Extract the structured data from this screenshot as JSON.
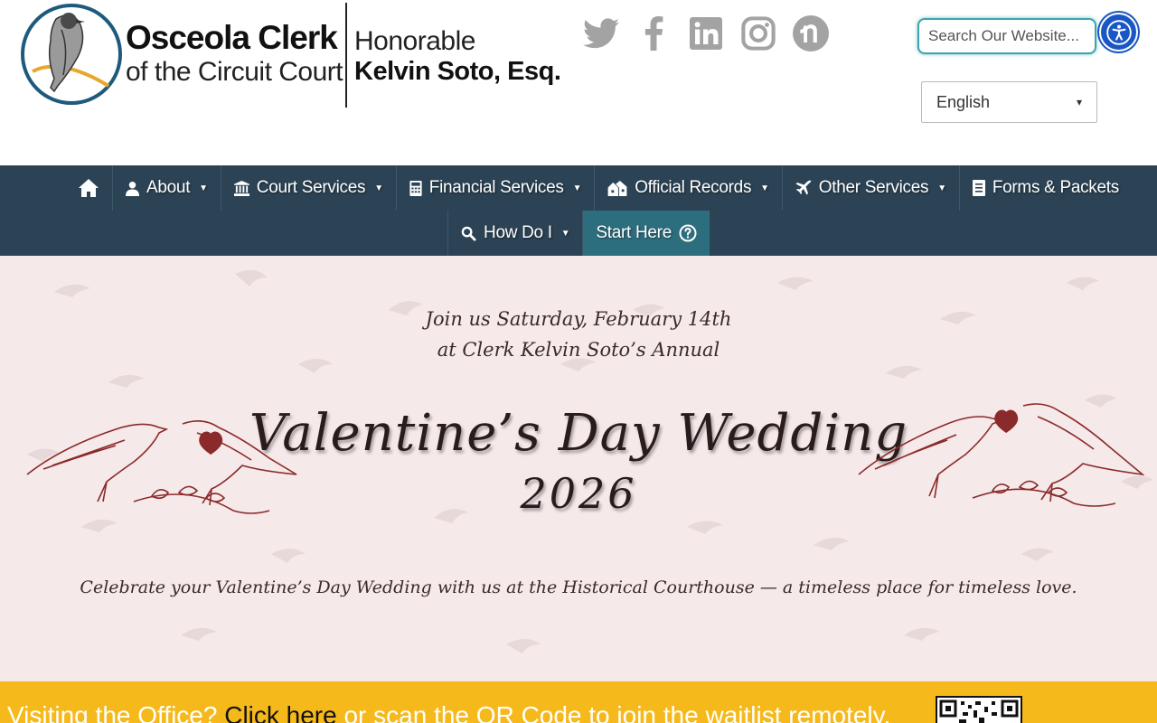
{
  "header": {
    "logo": {
      "name": "Osceola Clerk",
      "subtitle": "of the Circuit Court",
      "honorific": "Honorable",
      "clerk_name": "Kelvin Soto, Esq."
    },
    "socials": [
      {
        "icon": "twitter-icon"
      },
      {
        "icon": "facebook-icon"
      },
      {
        "icon": "linkedin-icon"
      },
      {
        "icon": "instagram-icon"
      },
      {
        "icon": "nextdoor-icon"
      }
    ],
    "search": {
      "placeholder": "Search Our Website..."
    },
    "accessibility_icon": "accessibility-icon",
    "language": {
      "selected": "English"
    }
  },
  "nav": {
    "items": [
      {
        "label": "About"
      },
      {
        "label": "Court Services"
      },
      {
        "label": "Financial Services"
      },
      {
        "label": "Official Records"
      },
      {
        "label": "Other Services"
      },
      {
        "label": "Forms & Packets"
      },
      {
        "label": "How Do I"
      },
      {
        "label": "Start Here"
      }
    ]
  },
  "hero": {
    "line1": "Join us Saturday, February 14th",
    "line2": "at Clerk Kelvin Soto’s Annual",
    "title": "Valentine’s Day Wedding",
    "year": "2026",
    "tagline": "Celebrate your Valentine’s Day Wedding with us at the Historical Courthouse — a timeless place for timeless love."
  },
  "banner": {
    "prefix": "Visiting the Office? ",
    "link": "Click here",
    "suffix": " or scan the QR Code to join the waitlist remotely."
  },
  "colors": {
    "nav_bg": "#2b4355",
    "start_here_bg": "#2d6e7e",
    "hero_bg": "#f6e9ea",
    "banner_bg": "#f6b91b",
    "accent_teal": "#3aa5ad",
    "a11y_blue": "#1a57c4",
    "bird_red": "#8b2a2a"
  }
}
